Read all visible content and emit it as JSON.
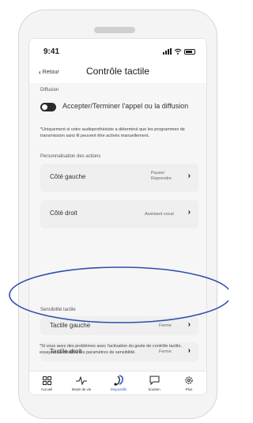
{
  "status_bar": {
    "time": "9:41"
  },
  "nav": {
    "back_label": "Retour",
    "title": "Contrôle tactile"
  },
  "diffusion": {
    "section_label": "Diffusion",
    "toggle_label": "Accepter/Terminer l'appel ou la diffusion",
    "note": "*Uniquement si votre audioprothésiste a déterminé que les programmes de transmission sans fil peuvent être activés manuellement."
  },
  "personalisation": {
    "section_label": "Personnalisation des actions",
    "items": [
      {
        "label": "Côté gauche",
        "value": "Pause/ Reprendre"
      },
      {
        "label": "Côté droit",
        "value": "Assistant vocal"
      }
    ]
  },
  "sensitivity": {
    "section_label": "Sensibilité tactile",
    "items": [
      {
        "label": "Tactile gauche",
        "value": "Ferme"
      },
      {
        "label": "Tactile droit",
        "value": "Ferme"
      }
    ],
    "note": "*Si vous avez des problèmes avec l'activation du geste de contrôle tactile, essayez de modifier les paramètres de sensibilité."
  },
  "tabbar": {
    "tabs": [
      {
        "label": "Accueil",
        "icon": "grid-icon"
      },
      {
        "label": "Mode de vie",
        "icon": "activity-icon"
      },
      {
        "label": "Dispositifs",
        "icon": "hearing-aid-icon",
        "active": true
      },
      {
        "label": "Soutien",
        "icon": "chat-icon"
      },
      {
        "label": "Plus",
        "icon": "gear-icon"
      }
    ]
  },
  "colors": {
    "accent": "#2f5bd2",
    "annotation": "#2f4fa8",
    "toggle": "#2b2b2b",
    "card_bg": "#efefef"
  }
}
